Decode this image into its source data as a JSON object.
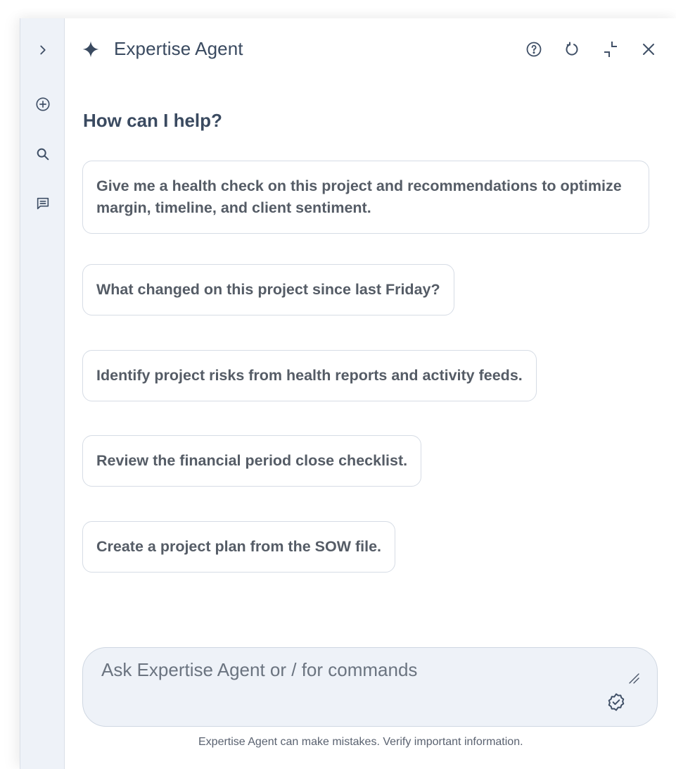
{
  "header": {
    "title": "Expertise Agent",
    "icons": [
      "sparkle-icon",
      "help-icon",
      "refresh-icon",
      "minimize-icon",
      "close-icon"
    ]
  },
  "rail": {
    "icons": [
      "chevron-right-icon",
      "add-circle-icon",
      "search-icon",
      "chat-icon"
    ]
  },
  "main": {
    "greeting": "How can I help?",
    "suggestions": [
      "Give me a health check on this project and recommendations to optimize margin, timeline, and client sentiment.",
      "What changed on this project since last Friday?",
      "Identify project risks from health reports and activity feeds.",
      "Review the financial period close checklist.",
      "Create a project plan from the SOW file."
    ]
  },
  "composer": {
    "placeholder": "Ask Expertise Agent or / for commands",
    "value": "",
    "icons": [
      "resize-icon",
      "verified-icon"
    ]
  },
  "footer": {
    "disclaimer": "Expertise Agent can make mistakes. Verify important information."
  },
  "colors": {
    "rail_background": "#eef2f8",
    "text_primary": "#3a4a60",
    "suggestion_text": "#555c66",
    "border": "#d6dce5"
  }
}
